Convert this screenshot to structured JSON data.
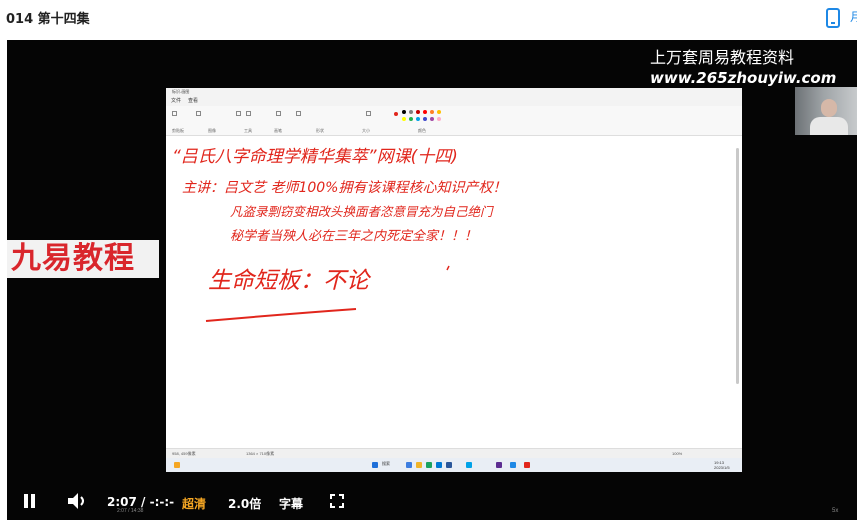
{
  "header": {
    "title": "014 第十四集",
    "right_glyph": "月"
  },
  "video": {
    "watermark_line1": "上万套周易教程资料",
    "watermark_line2": "www.265zhouyiw.com",
    "logo_text": "九易教程"
  },
  "screen": {
    "window_title": "标识-画图",
    "menu_file": "文件",
    "menu_view": "查看",
    "ribbon_groups": [
      "剪贴板",
      "图像",
      "工具",
      "画笔",
      "形状",
      "大小",
      "颜色"
    ],
    "status_left": "958, 459像素",
    "status_mid": "1364 × 710像素",
    "status_zoom": "100%",
    "taskbar_search": "搜索",
    "clock_time": "19:13",
    "clock_date": "2023/1/5",
    "palette": [
      "#000000",
      "#7f7f7f",
      "#c00000",
      "#ff0000",
      "#ff7f27",
      "#ffc000",
      "#ffff00",
      "#22b14c",
      "#00a2e8",
      "#3f48cc",
      "#a349a4",
      "#ffaec9"
    ],
    "handwriting": {
      "line1": "“吕氏八字命理学精华集萃”网课(十四)",
      "line2": "主讲：吕文艺 老师100%拥有该课程核心知识产权！",
      "line3": "凡盗录剽窃变相改头换面者恣意冒充为自己绝门",
      "line4": "秘学者当殃人必在三年之内死定全家！！！",
      "line5": "生命短板：不论"
    },
    "ink_color": "#e1261c"
  },
  "controls": {
    "time": "2:07 / -:-:-",
    "quality": "超清",
    "speed": "2.0倍",
    "subtitles": "字幕",
    "mini_caption": "2:07 / 14:38",
    "mini_right": "5x"
  }
}
